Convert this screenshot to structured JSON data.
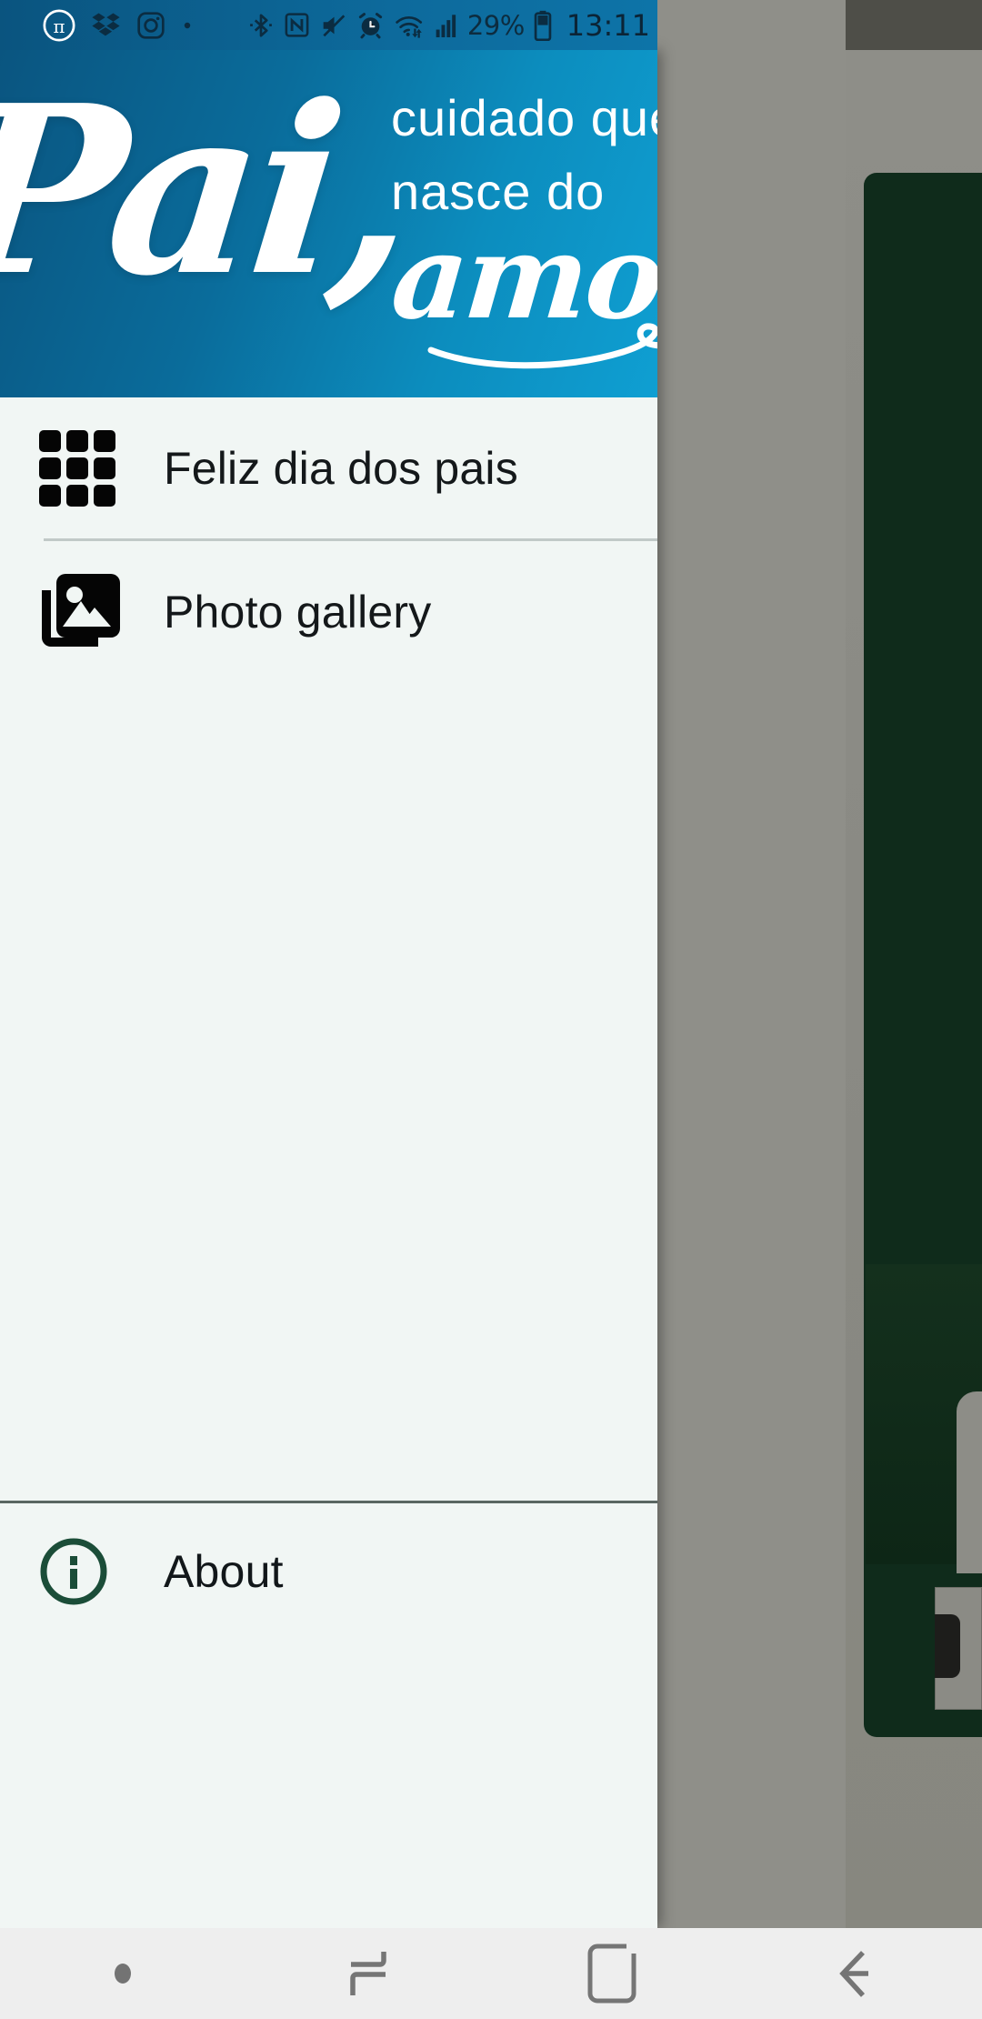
{
  "status_bar": {
    "notification_icons": [
      "pi-circle-icon",
      "dropbox-icon",
      "instagram-icon",
      "dot-icon"
    ],
    "system_icons": [
      "bluetooth-icon",
      "nfc-icon",
      "mute-icon",
      "alarm-icon",
      "wifi-icon",
      "signal-icon"
    ],
    "battery_percent": "29%",
    "battery_icon": "battery-icon",
    "time": "13:11",
    "text_color": "#0d2c3f",
    "background_color": "#0d6a9c"
  },
  "drawer": {
    "background_color": "#f1f6f4",
    "banner": {
      "headline": "Pai,",
      "line1": "cuidado que",
      "line2": "nasce do",
      "line3": "amor",
      "gradient_from": "#0a5580",
      "gradient_to": "#0f9fd2",
      "text_color": "#ffffff"
    },
    "menu_items": [
      {
        "label": "Feliz dia dos pais",
        "icon": "grid-apps-icon"
      },
      {
        "label": "Photo gallery",
        "icon": "photo-library-icon"
      }
    ],
    "footer": {
      "label": "About",
      "icon": "info-circle-icon",
      "icon_color": "#1b4d38"
    }
  },
  "nav_bar": {
    "background_color": "#eeeeee",
    "icon_color": "#757575",
    "buttons": [
      {
        "name": "indicator-dot",
        "icon": "dot-icon"
      },
      {
        "name": "recents",
        "icon": "recents-icon"
      },
      {
        "name": "home",
        "icon": "home-icon"
      },
      {
        "name": "back",
        "icon": "back-arrow-icon"
      }
    ]
  }
}
